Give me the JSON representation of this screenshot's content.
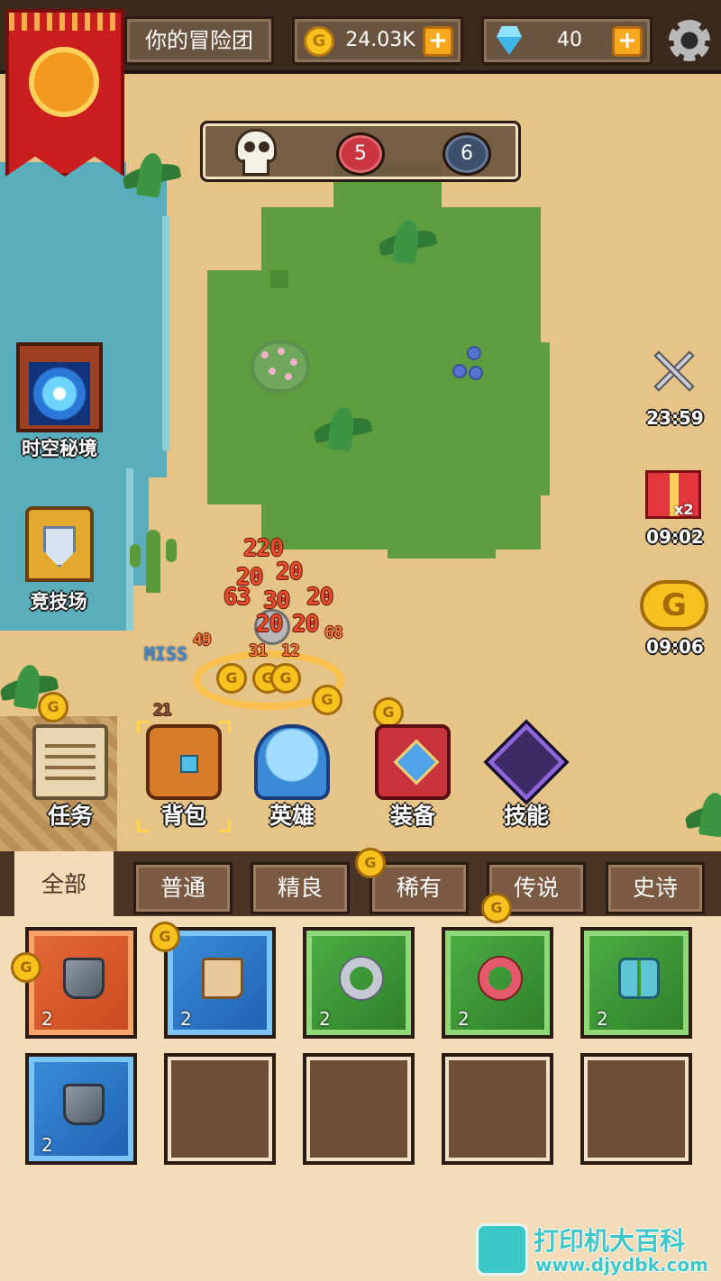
{
  "topbar": {
    "team_name": "你的冒险团",
    "gold": "24.03K",
    "gems": "40",
    "plus_label": "+"
  },
  "stage": {
    "red_count": "5",
    "blue_count": "6"
  },
  "side_left": {
    "portal_label": "时空秘境",
    "arena_label": "竞技场"
  },
  "side_right": {
    "battle_timer": "23:59",
    "gift_timer": "09:02",
    "gift_multiplier": "x2",
    "coin_timer": "09:06"
  },
  "battle": {
    "miss_text": "MISS",
    "damage_numbers": [
      "220",
      "20",
      "20",
      "20",
      "63",
      "30",
      "20",
      "20",
      "49",
      "31",
      "12",
      "20",
      "68",
      "21"
    ]
  },
  "menu": {
    "task": "任务",
    "bag": "背包",
    "hero": "英雄",
    "equip": "装备",
    "skill": "技能"
  },
  "tabs": [
    "全部",
    "普通",
    "精良",
    "稀有",
    "传说",
    "史诗"
  ],
  "inventory": {
    "slots": [
      {
        "rarity": "orange",
        "item": "gloves-icon",
        "count": "2"
      },
      {
        "rarity": "blue",
        "item": "boots-icon",
        "count": "2"
      },
      {
        "rarity": "green",
        "item": "ring-icon",
        "count": "2"
      },
      {
        "rarity": "green",
        "item": "ring-icon",
        "count": "2"
      },
      {
        "rarity": "green",
        "item": "bracers-icon",
        "count": "2"
      },
      {
        "rarity": "blue",
        "item": "gloves-icon",
        "count": "2"
      },
      {
        "rarity": "empty",
        "item": "",
        "count": ""
      },
      {
        "rarity": "empty",
        "item": "",
        "count": ""
      },
      {
        "rarity": "empty",
        "item": "",
        "count": ""
      },
      {
        "rarity": "empty",
        "item": "",
        "count": ""
      }
    ]
  },
  "watermark": {
    "title": "打印机大百科",
    "url": "www.djydbk.com"
  },
  "colors": {
    "rarity_orange": "#e46a3a",
    "rarity_blue": "#3a8fd9",
    "rarity_green": "#4caf45",
    "gold": "#f7c21e"
  }
}
